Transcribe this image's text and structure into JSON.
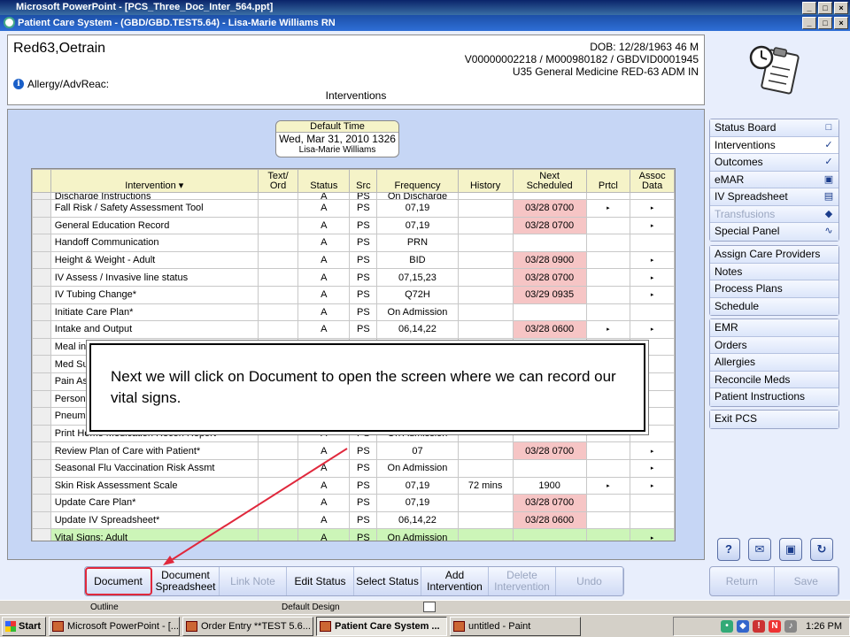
{
  "ppt_window": {
    "title": "Microsoft PowerPoint - [PCS_Three_Doc_Inter_564.ppt]",
    "status": {
      "outline": "Outline",
      "design": "Default Design"
    }
  },
  "app": {
    "title": "Patient Care System - (GBD/GBD.TEST5.64) - Lisa-Marie Williams RN"
  },
  "patient": {
    "name": "Red63,Oetrain",
    "dob": "DOB: 12/28/1963 46 M",
    "ids": "V00000002218 / M000980182 / GBDVID0001945",
    "location": "U35 General Medicine  RED-63  ADM IN",
    "allergy": "Allergy/AdvReac:",
    "section": "Interventions"
  },
  "default_time": {
    "label": "Default Time",
    "date": "Wed, Mar 31, 2010  1326",
    "user": "Lisa-Marie Williams"
  },
  "grid": {
    "headers": {
      "intervention": "Intervention ▾",
      "text_ord_1": "Text/",
      "text_ord_2": "Ord",
      "status": "Status",
      "src": "Src",
      "frequency": "Frequency",
      "history": "History",
      "next_1": "Next",
      "next_2": "Scheduled",
      "prtcl": "Prtcl",
      "assoc_1": "Assoc",
      "assoc_2": "Data"
    },
    "partial_row": {
      "name": "Discharge Instructions",
      "status": "A",
      "src": "PS",
      "freq": "On Discharge"
    },
    "rows": [
      {
        "name": "Fall Risk / Safety Assessment Tool",
        "status": "A",
        "src": "PS",
        "freq": "07,19",
        "history": "",
        "next": "03/28 0700",
        "red": true,
        "prtcl": "▸",
        "assoc": "▸"
      },
      {
        "name": "General Education Record",
        "status": "A",
        "src": "PS",
        "freq": "07,19",
        "history": "",
        "next": "03/28 0700",
        "red": true,
        "prtcl": "",
        "assoc": "▸"
      },
      {
        "name": "Handoff Communication",
        "status": "A",
        "src": "PS",
        "freq": "PRN",
        "history": "",
        "next": "",
        "red": false,
        "prtcl": "",
        "assoc": ""
      },
      {
        "name": "Height & Weight - Adult",
        "status": "A",
        "src": "PS",
        "freq": "BID",
        "history": "",
        "next": "03/28 0900",
        "red": true,
        "prtcl": "",
        "assoc": "▸"
      },
      {
        "name": "IV Assess / Invasive line status",
        "status": "A",
        "src": "PS",
        "freq": "07,15,23",
        "history": "",
        "next": "03/28 0700",
        "red": true,
        "prtcl": "",
        "assoc": "▸"
      },
      {
        "name": "IV Tubing Change*",
        "status": "A",
        "src": "PS",
        "freq": "Q72H",
        "history": "",
        "next": "03/29 0935",
        "red": true,
        "prtcl": "",
        "assoc": "▸"
      },
      {
        "name": "Initiate Care Plan*",
        "status": "A",
        "src": "PS",
        "freq": "On Admission",
        "history": "",
        "next": "",
        "red": false,
        "prtcl": "",
        "assoc": ""
      },
      {
        "name": "Intake and Output",
        "status": "A",
        "src": "PS",
        "freq": "06,14,22",
        "history": "",
        "next": "03/28 0600",
        "red": true,
        "prtcl": "▸",
        "assoc": "▸"
      },
      {
        "name": "Meal int",
        "status": "",
        "src": "",
        "freq": "",
        "history": "",
        "next": "",
        "red": false,
        "prtcl": "",
        "assoc": ""
      },
      {
        "name": "Med Su",
        "status": "",
        "src": "",
        "freq": "",
        "history": "",
        "next": "",
        "red": false,
        "prtcl": "",
        "assoc": ""
      },
      {
        "name": "Pain As",
        "status": "",
        "src": "",
        "freq": "",
        "history": "",
        "next": "",
        "red": false,
        "prtcl": "",
        "assoc": ""
      },
      {
        "name": "Persona",
        "status": "",
        "src": "",
        "freq": "",
        "history": "",
        "next": "",
        "red": false,
        "prtcl": "",
        "assoc": ""
      },
      {
        "name": "Pneumo",
        "status": "",
        "src": "",
        "freq": "",
        "history": "",
        "next": "",
        "red": false,
        "prtcl": "",
        "assoc": ""
      },
      {
        "name": "Print Home Medication Recon Report*",
        "status": "A",
        "src": "PS",
        "freq": "On Admission",
        "history": "",
        "next": "",
        "red": false,
        "prtcl": "",
        "assoc": ""
      },
      {
        "name": "Review Plan of Care with Patient*",
        "status": "A",
        "src": "PS",
        "freq": "07",
        "history": "",
        "next": "03/28 0700",
        "red": true,
        "prtcl": "",
        "assoc": "▸"
      },
      {
        "name": "Seasonal Flu Vaccination Risk Assmt",
        "status": "A",
        "src": "PS",
        "freq": "On Admission",
        "history": "",
        "next": "",
        "red": false,
        "prtcl": "",
        "assoc": "▸"
      },
      {
        "name": "Skin Risk Assessment Scale",
        "status": "A",
        "src": "PS",
        "freq": "07,19",
        "history": "72 mins",
        "next": "1900",
        "red": false,
        "prtcl": "▸",
        "assoc": "▸"
      },
      {
        "name": "Update Care Plan*",
        "status": "A",
        "src": "PS",
        "freq": "07,19",
        "history": "",
        "next": "03/28 0700",
        "red": true,
        "prtcl": "",
        "assoc": ""
      },
      {
        "name": "Update IV Spreadsheet*",
        "status": "A",
        "src": "PS",
        "freq": "06,14,22",
        "history": "",
        "next": "03/28 0600",
        "red": true,
        "prtcl": "",
        "assoc": ""
      },
      {
        "name": "Vital Signs: Adult",
        "status": "A",
        "src": "PS",
        "freq": "On Admission",
        "history": "",
        "next": "",
        "red": false,
        "green": true,
        "prtcl": "",
        "assoc": "▸"
      }
    ]
  },
  "callout": {
    "text": "Next we will click on Document to open the screen where we can record our vital signs."
  },
  "nav": {
    "group1": [
      {
        "label": "Status Board",
        "icon": "□",
        "state": "normal"
      },
      {
        "label": "Interventions",
        "icon": "✓",
        "state": "active"
      },
      {
        "label": "Outcomes",
        "icon": "✓",
        "state": "normal"
      },
      {
        "label": "eMAR",
        "icon": "▣",
        "state": "normal"
      },
      {
        "label": "IV Spreadsheet",
        "icon": "▤",
        "state": "normal"
      },
      {
        "label": "Transfusions",
        "icon": "◆",
        "state": "disabled"
      },
      {
        "label": "Special Panel",
        "icon": "∿",
        "state": "normal"
      }
    ],
    "group2": [
      "Assign Care Providers",
      "Notes",
      "Process Plans",
      "Schedule"
    ],
    "group3": [
      "EMR",
      "Orders",
      "Allergies",
      "Reconcile Meds",
      "Patient Instructions"
    ],
    "group4": [
      "Exit PCS"
    ]
  },
  "util_buttons": [
    "?",
    "✉",
    "▣",
    "↻"
  ],
  "actions": [
    {
      "label": "Document",
      "state": "focused"
    },
    {
      "label": "Document Spreadsheet",
      "state": "normal"
    },
    {
      "label": "Link Note",
      "state": "disabled"
    },
    {
      "label": "Edit Status",
      "state": "normal"
    },
    {
      "label": "Select Status",
      "state": "normal"
    },
    {
      "label": "Add Intervention",
      "state": "normal"
    },
    {
      "label": "Delete Intervention",
      "state": "disabled"
    },
    {
      "label": "Undo",
      "state": "disabled"
    }
  ],
  "nav_actions": [
    {
      "label": "Return",
      "state": "disabled"
    },
    {
      "label": "Save",
      "state": "disabled"
    }
  ],
  "taskbar": {
    "start": "Start",
    "tasks": [
      {
        "label": "Microsoft PowerPoint - [...",
        "active": false
      },
      {
        "label": "Order Entry **TEST 5.6...",
        "active": false
      },
      {
        "label": "Patient Care System ...",
        "active": true
      },
      {
        "label": "untitled - Paint",
        "active": false
      }
    ],
    "clock": "1:26 PM"
  },
  "colors": {
    "accent_red": "#e0283c",
    "scheduled_overdue": "#f6c5c5",
    "row_selected": "#ccf5b8",
    "header_yellow": "#f5f3c8"
  }
}
